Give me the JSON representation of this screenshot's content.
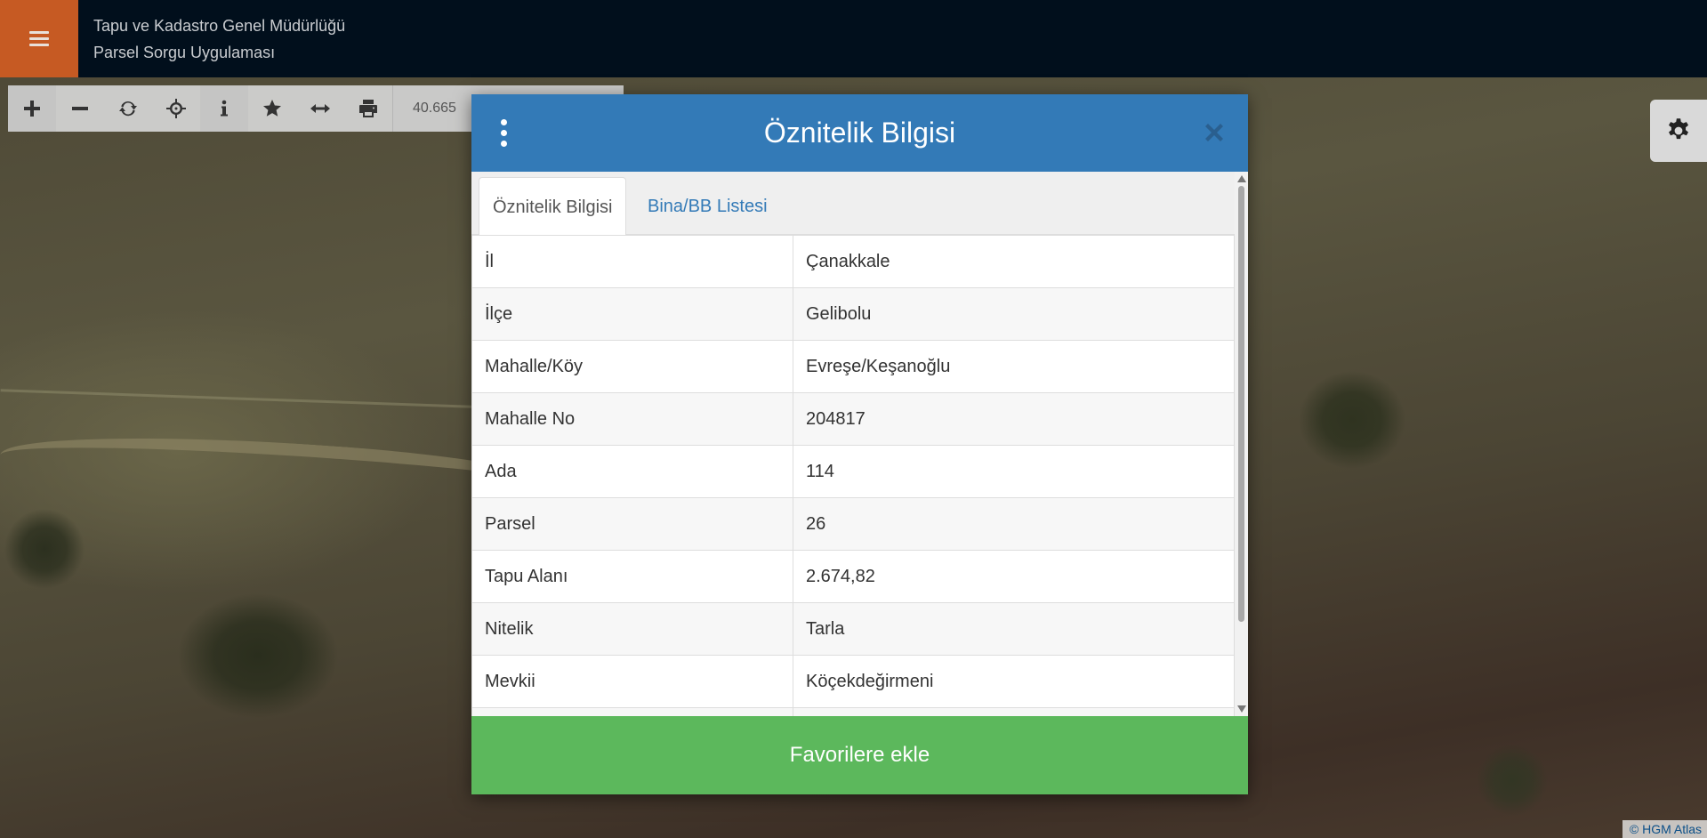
{
  "header": {
    "org_name": "Tapu ve Kadastro Genel Müdürlüğü",
    "app_name": "Parsel Sorgu Uygulaması"
  },
  "toolbar": {
    "coordinate_text": "40.665",
    "tools": [
      "plus-icon",
      "minus-icon",
      "refresh-icon",
      "crosshair-icon",
      "info-icon",
      "star-icon",
      "arrows-h-icon",
      "print-icon"
    ]
  },
  "modal": {
    "title": "Öznitelik Bilgisi",
    "tabs": [
      {
        "label": "Öznitelik Bilgisi",
        "active": true
      },
      {
        "label": "Bina/BB Listesi",
        "active": false
      }
    ],
    "rows": [
      {
        "key": "İl",
        "value": "Çanakkale"
      },
      {
        "key": "İlçe",
        "value": "Gelibolu"
      },
      {
        "key": "Mahalle/Köy",
        "value": "Evreşe/Keşanoğlu"
      },
      {
        "key": "Mahalle No",
        "value": "204817"
      },
      {
        "key": "Ada",
        "value": "114"
      },
      {
        "key": "Parsel",
        "value": "26"
      },
      {
        "key": "Tapu Alanı",
        "value": "2.674,82"
      },
      {
        "key": "Nitelik",
        "value": "Tarla"
      },
      {
        "key": "Mevkii",
        "value": "Köçekdeğirmeni"
      }
    ],
    "favorite_button": "Favorilere ekle"
  },
  "attribution": "© HGM Atlas",
  "colors": {
    "menu_button": "#c65a23",
    "topbar": "#010f1c",
    "modal_header": "#337ab7",
    "favorite_button": "#5cb85c"
  }
}
